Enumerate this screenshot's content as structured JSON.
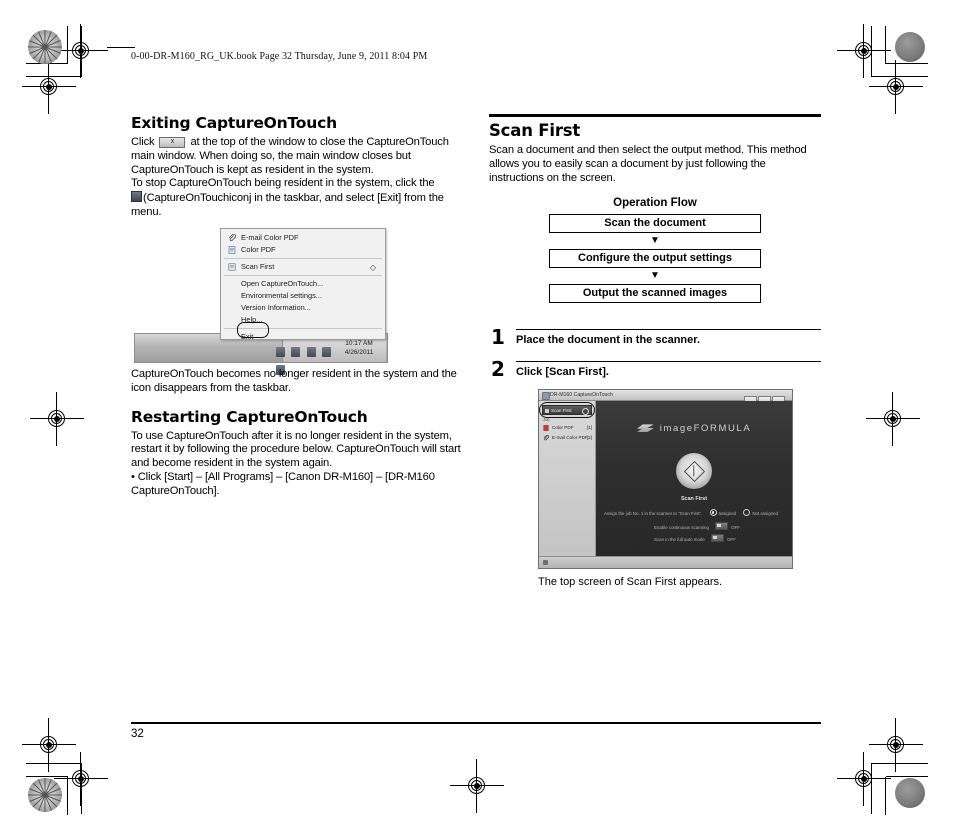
{
  "header": {
    "slug": "0-00-DR-M160_RG_UK.book  Page 32  Thursday, June 9, 2011  8:04 PM"
  },
  "left_column": {
    "section1": {
      "heading": "Exiting CaptureOnTouch",
      "para1_a": "Click",
      "para1_b": "at the top of the window to close the CaptureOnTouch main window. When doing so, the main window closes but CaptureOnTouch is kept as resident in the system.",
      "para2_a": "To stop CaptureOnTouch being resident in the system, click the",
      "para2_b": "(CaptureOnTouchiconj in the taskbar, and select [Exit] from the menu.",
      "figure_caption": "CaptureOnTouch becomes no longer resident in the system and the icon disappears from the taskbar."
    },
    "context_menu": {
      "items": [
        {
          "label": "E-mail Color PDF",
          "icon": "paperclip-icon",
          "right": ""
        },
        {
          "label": "Color PDF",
          "icon": "document-icon",
          "right": ""
        },
        {
          "label": "Scan First",
          "icon": "scan-icon",
          "right": "◇"
        },
        {
          "label": "Open CaptureOnTouch...",
          "icon": "",
          "right": ""
        },
        {
          "label": "Environmental settings...",
          "icon": "",
          "right": ""
        },
        {
          "label": "Version Information...",
          "icon": "",
          "right": ""
        },
        {
          "label": "Help...",
          "icon": "",
          "right": ""
        },
        {
          "label": "Exit",
          "icon": "",
          "right": ""
        }
      ]
    },
    "taskbar": {
      "clock_time": "10:17 AM",
      "clock_date": "4/26/2011"
    },
    "section2": {
      "heading": "Restarting CaptureOnTouch",
      "para1": "To use CaptureOnTouch after it is no longer resident in the system, restart it by following the procedure below. CaptureOnTouch will start and become resident in the system again.",
      "bullet1": "• Click [Start] – [All Programs] – [Canon DR-M160] – [DR-M160 CaptureOnTouch]."
    }
  },
  "right_column": {
    "heading": "Scan First",
    "intro": "Scan a document and then select the output method. This method allows you to easily scan a document by just following the instructions on the screen.",
    "flow": {
      "title": "Operation Flow",
      "steps": [
        "Scan the document",
        "Configure the output settings",
        "Output the scanned images"
      ],
      "arrow": "▼"
    },
    "numbered_steps": [
      {
        "num": "1",
        "text": "Place the document in the scanner."
      },
      {
        "num": "2",
        "text": "Click [Scan First]."
      }
    ],
    "screenshot": {
      "window_title": "DR-M160 CaptureOnTouch",
      "brand": "imageFORMULA",
      "scan_label": "Scan First",
      "selected_item": "Scan First",
      "sidebar_heading": "Job",
      "sidebar_items": [
        {
          "label": "Color PDF",
          "count": "[1]",
          "icon": "document-icon"
        },
        {
          "label": "E-mail Color PDF",
          "count": "[2]",
          "icon": "paperclip-icon"
        }
      ],
      "options": [
        {
          "label": "Assign the job No. 1 in the scanner to \"Scan First\".",
          "choices": [
            {
              "label": "assigned",
              "selected": true
            },
            {
              "label": "Not assigned",
              "selected": false
            }
          ]
        },
        {
          "label": "Enable continuous scanning",
          "toggle": "OFF"
        },
        {
          "label": "Scan in the full auto mode",
          "toggle": "OFF"
        }
      ],
      "window_buttons": [
        "minimize",
        "maximize",
        "close"
      ]
    },
    "caption": "The top screen of Scan First appears."
  },
  "footer": {
    "page_number": "32"
  }
}
